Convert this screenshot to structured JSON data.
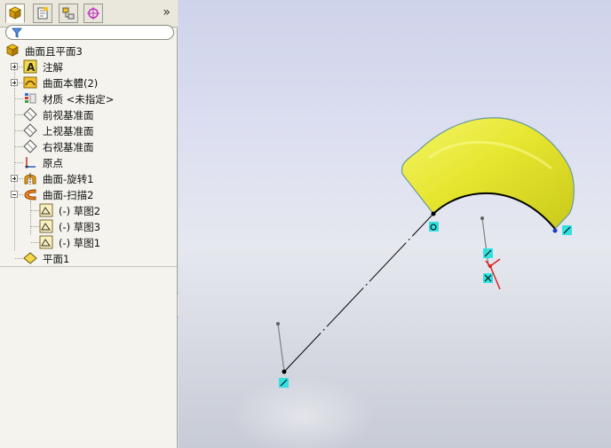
{
  "feature_manager": {
    "tabs": [
      {
        "icon": "feature-manager-icon",
        "active": true
      },
      {
        "icon": "property-manager-icon",
        "active": false
      },
      {
        "icon": "configuration-manager-icon",
        "active": false
      },
      {
        "icon": "dimxpert-manager-icon",
        "active": false
      }
    ],
    "expand_symbol": "»",
    "filter_icon": "filter-icon",
    "tree": [
      {
        "label": "曲面且平面3",
        "icon": "part-icon",
        "expander": "none",
        "indent": 0
      },
      {
        "label": "注解",
        "icon": "annotations-icon",
        "expander": "plus",
        "indent": 1
      },
      {
        "label": "曲面本體(2)",
        "icon": "surface-bodies-icon",
        "expander": "plus",
        "indent": 1
      },
      {
        "label": "材质 <未指定>",
        "icon": "material-icon",
        "expander": "none",
        "indent": 1
      },
      {
        "label": "前视基准面",
        "icon": "plane-icon",
        "expander": "none",
        "indent": 1
      },
      {
        "label": "上视基准面",
        "icon": "plane-icon",
        "expander": "none",
        "indent": 1
      },
      {
        "label": "右视基准面",
        "icon": "plane-icon",
        "expander": "none",
        "indent": 1
      },
      {
        "label": "原点",
        "icon": "origin-icon",
        "expander": "none",
        "indent": 1
      },
      {
        "label": "曲面-旋转1",
        "icon": "surface-revolve-icon",
        "expander": "plus",
        "indent": 1
      },
      {
        "label": "曲面-扫描2",
        "icon": "surface-sweep-icon",
        "expander": "minus",
        "indent": 1
      },
      {
        "label": "(-) 草图2",
        "icon": "sketch-icon",
        "expander": "none",
        "indent": 2
      },
      {
        "label": "(-) 草图3",
        "icon": "sketch-icon",
        "expander": "none",
        "indent": 2
      },
      {
        "label": "(-) 草图1",
        "icon": "sketch-icon",
        "expander": "none",
        "indent": 2
      },
      {
        "label": "平面1",
        "icon": "plane-feature-icon",
        "expander": "none",
        "indent": 1
      }
    ]
  },
  "colors": {
    "surface_yellow": "#ecec3c",
    "surface_edge": "#6a9a9a",
    "sketch_line": "#000000",
    "endpoint_marker": "#33e0e0",
    "triad_red": "#e02020"
  }
}
